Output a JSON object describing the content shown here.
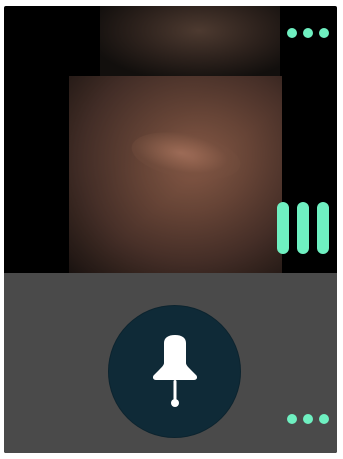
{
  "screen": {
    "title": "",
    "accent_color": "#6ff0c1",
    "panel_color": "#4a4a4a",
    "circle_color": "#0f2a37"
  },
  "icons": {
    "top_menu": "more-horizontal-icon",
    "side_bars": "vertical-bars-icon",
    "pin": "pushpin-icon",
    "bottom_menu": "more-horizontal-icon"
  }
}
